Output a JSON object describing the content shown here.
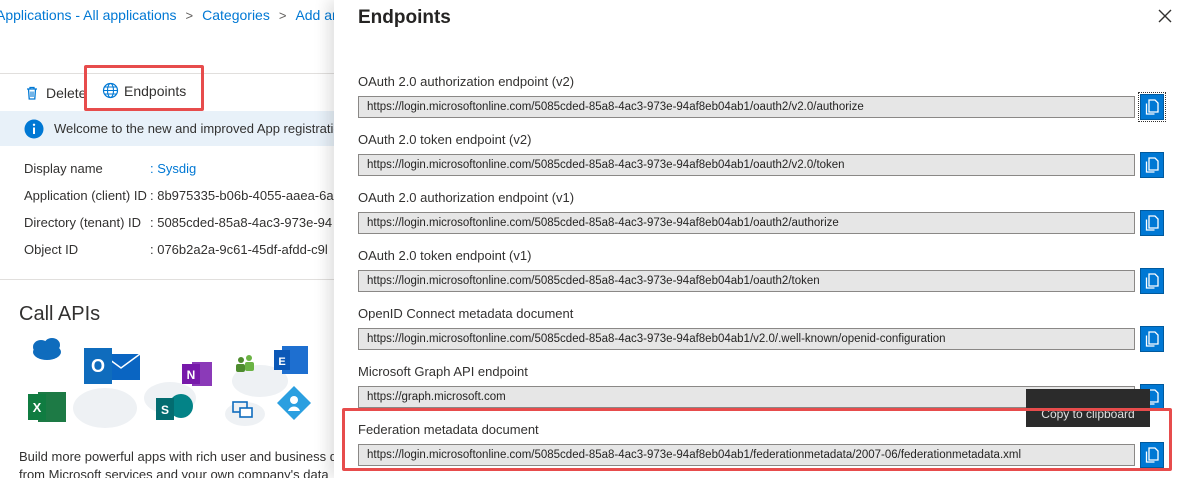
{
  "breadcrumb": {
    "items": [
      "Applications - All applications",
      "Categories",
      "Add an app"
    ],
    "separator": ">"
  },
  "toolbar": {
    "delete_label": "Delete",
    "endpoints_label": "Endpoints"
  },
  "info_banner": {
    "text": "Welcome to the new and improved App registrations"
  },
  "properties": [
    {
      "label": "Display name",
      "value": ": Sysdig",
      "link": true
    },
    {
      "label": "Application (client) ID",
      "value": ": 8b975335-b06b-4055-aaea-6a",
      "link": false
    },
    {
      "label": "Directory (tenant) ID",
      "value": ": 5085cded-85a8-4ac3-973e-94",
      "link": false
    },
    {
      "label": "Object ID",
      "value": ": 076b2a2a-9c61-45df-afdd-c9l",
      "link": false
    }
  ],
  "call_apis": {
    "title": "Call APIs",
    "description_line1": "Build more powerful apps with rich user and business d",
    "description_line2": "from Microsoft services and your own company's data"
  },
  "panel": {
    "title": "Endpoints",
    "tooltip": "Copy to clipboard",
    "endpoints": [
      {
        "label": "OAuth 2.0 authorization endpoint (v2)",
        "value": "https://login.microsoftonline.com/5085cded-85a8-4ac3-973e-94af8eb04ab1/oauth2/v2.0/authorize"
      },
      {
        "label": "OAuth 2.0 token endpoint (v2)",
        "value": "https://login.microsoftonline.com/5085cded-85a8-4ac3-973e-94af8eb04ab1/oauth2/v2.0/token"
      },
      {
        "label": "OAuth 2.0 authorization endpoint (v1)",
        "value": "https://login.microsoftonline.com/5085cded-85a8-4ac3-973e-94af8eb04ab1/oauth2/authorize"
      },
      {
        "label": "OAuth 2.0 token endpoint (v1)",
        "value": "https://login.microsoftonline.com/5085cded-85a8-4ac3-973e-94af8eb04ab1/oauth2/token"
      },
      {
        "label": "OpenID Connect metadata document",
        "value": "https://login.microsoftonline.com/5085cded-85a8-4ac3-973e-94af8eb04ab1/v2.0/.well-known/openid-configuration"
      },
      {
        "label": "Microsoft Graph API endpoint",
        "value": "https://graph.microsoft.com"
      },
      {
        "label": "Federation metadata document",
        "value": "https://login.microsoftonline.com/5085cded-85a8-4ac3-973e-94af8eb04ab1/federationmetadata/2007-06/federationmetadata.xml"
      }
    ]
  },
  "colors": {
    "accent": "#0078d4",
    "highlight_border": "#e74c4c",
    "info_background": "#e8f1f9",
    "field_background": "#e6e6e6"
  },
  "icons": [
    "trash-icon",
    "globe-icon",
    "info-icon",
    "close-icon",
    "copy-icon",
    "cloud-icon",
    "outlook-icon",
    "onenote-icon",
    "people-icon",
    "exchange-icon",
    "excel-icon",
    "sharepoint-icon",
    "azure-ad-icon"
  ]
}
